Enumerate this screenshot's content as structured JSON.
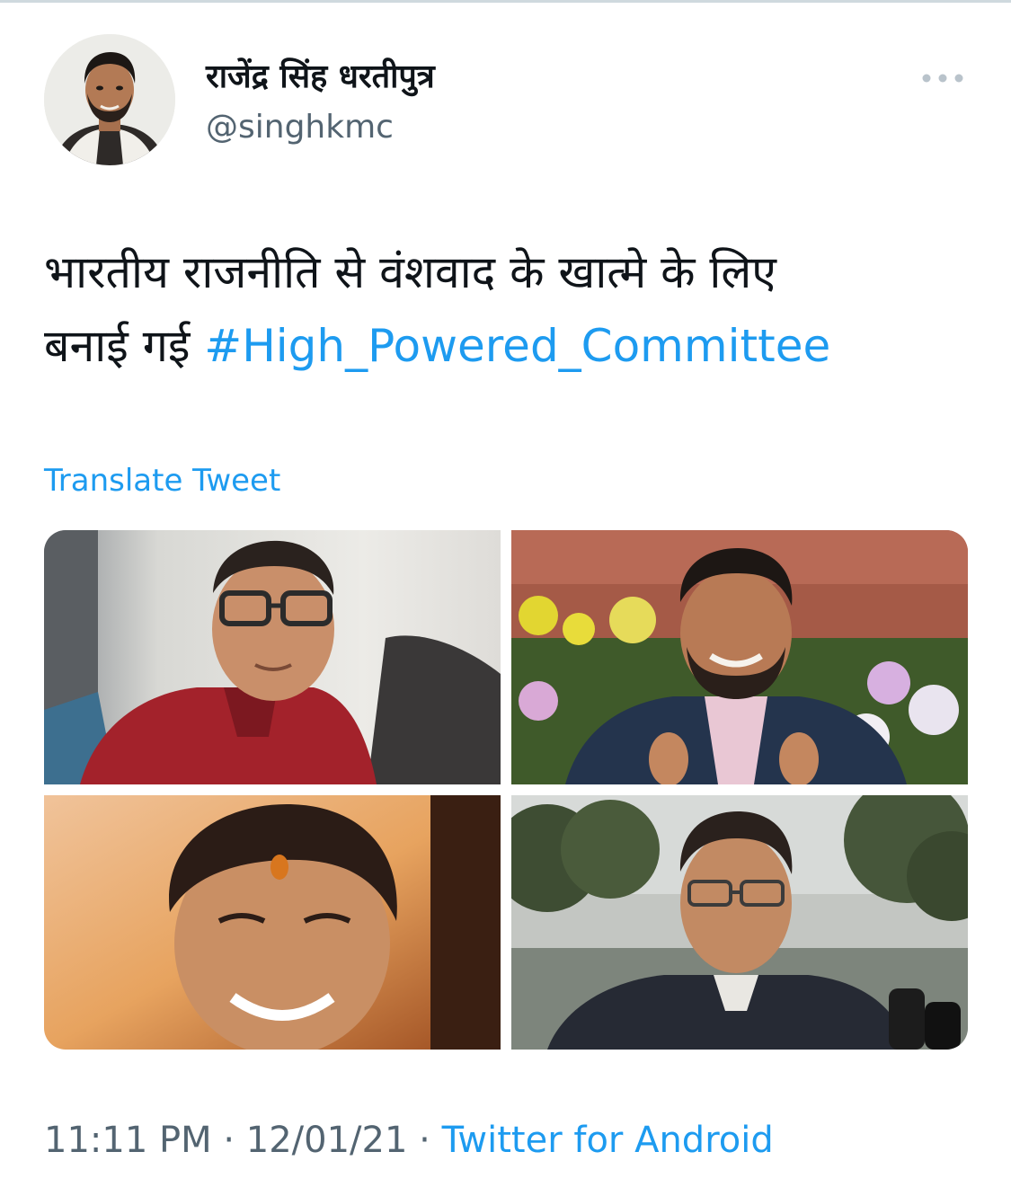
{
  "tweet": {
    "author": {
      "display_name": "राजेंद्र सिंह धरतीपुत्र",
      "handle": "@singhkmc"
    },
    "text": {
      "line1": "भारतीय राजनीति से वंशवाद के खात्मे के लिए",
      "line2_prefix": "बनाई गई ",
      "hashtag": "#High_Powered_Committee"
    },
    "translate_label": "Translate Tweet",
    "media_count": 4,
    "meta": {
      "time": "11:11 PM",
      "separator": " · ",
      "date": "12/01/21",
      "source": "Twitter for Android"
    }
  },
  "icons": {
    "more": "more-horizontal-icon"
  },
  "colors": {
    "text": "#0f1419",
    "secondary": "#536471",
    "link": "#1d9bf0",
    "divider": "#cfd9de"
  }
}
